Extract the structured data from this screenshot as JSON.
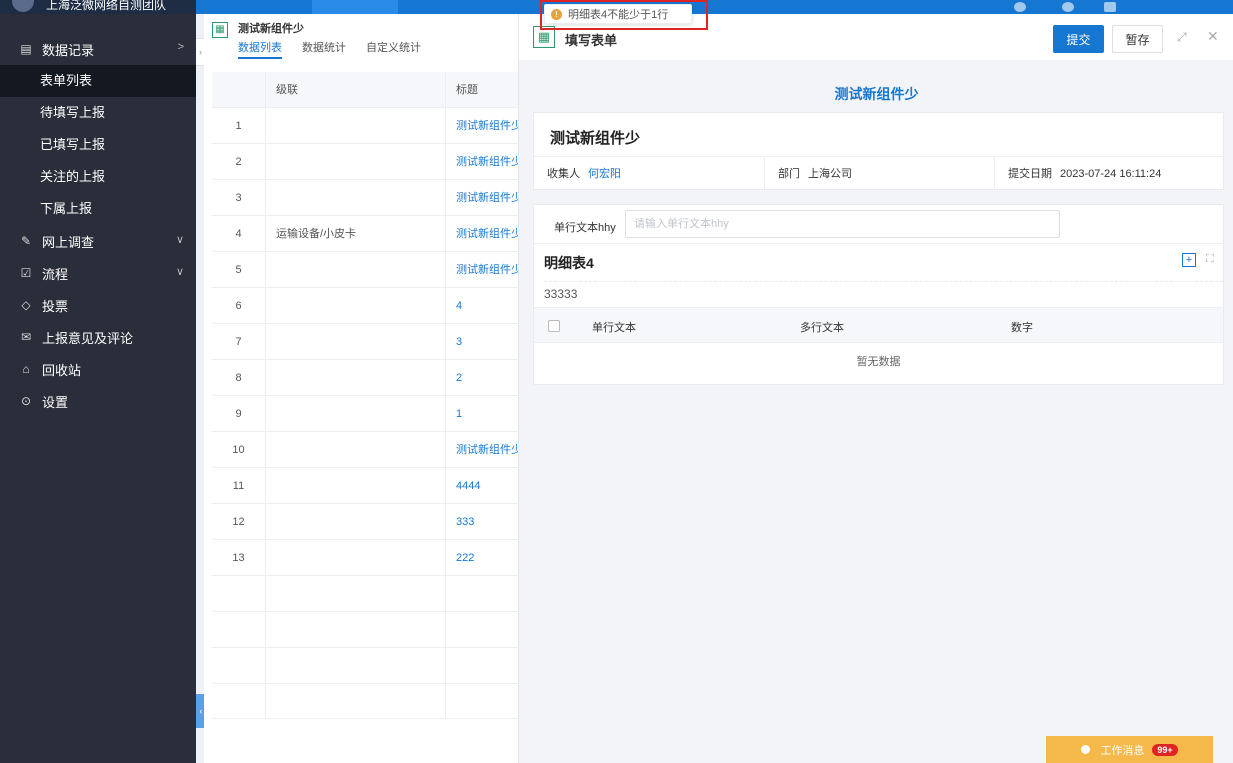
{
  "header": {
    "org_name": "上海泛微网络自测团队"
  },
  "sidebar": {
    "items": [
      {
        "label": "数据记录",
        "icon": "document-icon",
        "arrow": ">"
      },
      {
        "label": "网上调查",
        "icon": "edit-icon",
        "arrow": "∨"
      },
      {
        "label": "流程",
        "icon": "flow-icon",
        "arrow": "∨"
      },
      {
        "label": "投票",
        "icon": "vote-icon"
      },
      {
        "label": "上报意见及评论",
        "icon": "comment-icon"
      },
      {
        "label": "回收站",
        "icon": "trash-icon"
      },
      {
        "label": "设置",
        "icon": "gear-icon"
      }
    ],
    "subitems": [
      "表单列表",
      "待填写上报",
      "已填写上报",
      "关注的上报",
      "下属上报"
    ]
  },
  "list_panel": {
    "title": "测试新组件少",
    "tabs": [
      "数据列表",
      "数据统计",
      "自定义统计"
    ],
    "columns": {
      "cascade": "级联",
      "title": "标题"
    },
    "rows": [
      {
        "idx": "1",
        "cascade": "",
        "title": "测试新组件少"
      },
      {
        "idx": "2",
        "cascade": "",
        "title": "测试新组件少"
      },
      {
        "idx": "3",
        "cascade": "",
        "title": "测试新组件少"
      },
      {
        "idx": "4",
        "cascade": "运输设备/小皮卡",
        "title": "测试新组件少"
      },
      {
        "idx": "5",
        "cascade": "",
        "title": "测试新组件少"
      },
      {
        "idx": "6",
        "cascade": "",
        "title": "4"
      },
      {
        "idx": "7",
        "cascade": "",
        "title": "3"
      },
      {
        "idx": "8",
        "cascade": "",
        "title": "2"
      },
      {
        "idx": "9",
        "cascade": "",
        "title": "1"
      },
      {
        "idx": "10",
        "cascade": "",
        "title": "测试新组件少"
      },
      {
        "idx": "11",
        "cascade": "",
        "title": "4444"
      },
      {
        "idx": "12",
        "cascade": "",
        "title": "333"
      },
      {
        "idx": "13",
        "cascade": "",
        "title": "222"
      }
    ]
  },
  "form_panel": {
    "header_title": "填写表单",
    "submit_label": "提交",
    "save_label": "暂存",
    "form_heading": "测试新组件少",
    "card_title": "测试新组件少",
    "collector_label": "收集人",
    "collector_value": "何宏阳",
    "dept_label": "部门",
    "dept_value": "上海公司",
    "date_label": "提交日期",
    "date_value": "2023-07-24 16:11:24",
    "text_field_label": "单行文本hhy",
    "text_field_placeholder": "请输入单行文本hhy",
    "subtable_title": "明细表4",
    "subtable_desc": "33333",
    "subtable_columns": [
      "单行文本",
      "多行文本",
      "数字"
    ],
    "empty_text": "暂无数据"
  },
  "toast": {
    "message": "明细表4不能少于1行",
    "type": "warning",
    "color": "#e6a23c"
  },
  "work_message": {
    "label": "工作消息",
    "badge": "99+"
  },
  "colors": {
    "primary": "#1677d2",
    "sidebar_bg": "#2a2e3a",
    "highlight_border": "#e02424"
  }
}
